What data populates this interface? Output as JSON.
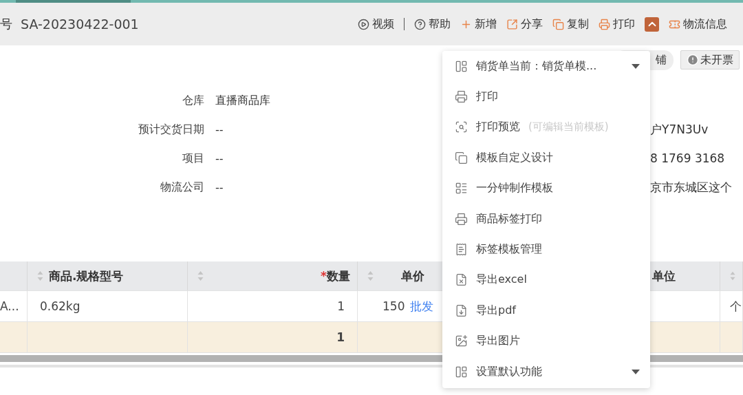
{
  "header": {
    "doc_label": "号",
    "doc_number": "SA-20230422-001",
    "actions": [
      {
        "label": "视频",
        "kind": "plain"
      },
      {
        "kind": "separator"
      },
      {
        "label": "帮助",
        "kind": "plain"
      },
      {
        "label": "新增",
        "kind": "accent"
      },
      {
        "label": "分享",
        "kind": "accent"
      },
      {
        "label": "复制",
        "kind": "accent"
      },
      {
        "label": "打印",
        "kind": "accent"
      },
      {
        "kind": "collapse"
      },
      {
        "label": "物流信息",
        "kind": "accent"
      }
    ]
  },
  "status": {
    "tag": "铺",
    "invoice_button": "未开票"
  },
  "fields": [
    {
      "label": "仓库",
      "value": "直播商品库"
    },
    {
      "label": "预计交货日期",
      "value": "--"
    },
    {
      "label": "项目",
      "value": "--"
    },
    {
      "label": "物流公司",
      "value": "--"
    }
  ],
  "side_fields": [
    "户Y7N3Uv",
    "8 1769 3168",
    "京市东城区这个"
  ],
  "table": {
    "columns": [
      {
        "sortable": false
      },
      {
        "label": "商品.规格型号",
        "sortable": true
      },
      {
        "label": "数量",
        "sortable": true,
        "required_mark": "*"
      },
      {
        "label": "单价",
        "sortable": true
      },
      {
        "label": "单位",
        "sortable": false
      },
      {
        "sortable": true
      }
    ],
    "rows": [
      {
        "cells": [
          {
            "text": "A..."
          },
          {
            "text": "0.62kg"
          },
          {
            "text": "1"
          },
          {
            "text": "150",
            "link": "批发"
          },
          {},
          {
            "text": "个"
          }
        ]
      }
    ],
    "summary": {
      "quantity": "1"
    }
  },
  "menu": {
    "items": [
      {
        "label": "销货单当前：销货单模...",
        "kind": "select"
      },
      {
        "label": "打印",
        "kind": "action"
      },
      {
        "label": "打印预览",
        "hint": "(可编辑当前模板)",
        "kind": "action"
      },
      {
        "label": "模板自定义设计",
        "kind": "action"
      },
      {
        "label": "一分钟制作模板",
        "kind": "action"
      },
      {
        "label": "商品标签打印",
        "kind": "action"
      },
      {
        "label": "标签模板管理",
        "kind": "action"
      },
      {
        "label": "导出excel",
        "kind": "action"
      },
      {
        "label": "导出pdf",
        "kind": "action"
      },
      {
        "label": "导出图片",
        "kind": "action"
      },
      {
        "label": "设置默认功能",
        "kind": "select"
      }
    ]
  }
}
